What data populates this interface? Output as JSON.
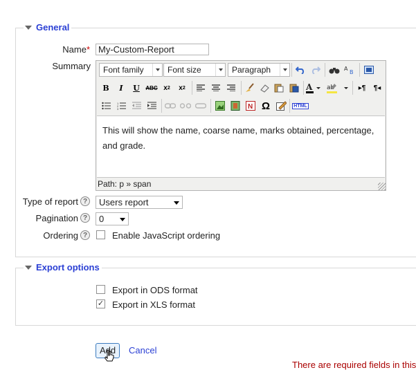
{
  "general": {
    "legend": "General",
    "name_label": "Name",
    "name_required_mark": "*",
    "name_value": "My-Custom-Report",
    "summary_label": "Summary",
    "editor": {
      "font_family": "Font family",
      "font_size": "Font size",
      "format": "Paragraph",
      "content": "This will show the name, coarse name, marks obtained, percentage, and  grade.",
      "path": "Path: p » span",
      "html_button": "HTML"
    },
    "type_label": "Type of report",
    "type_value": "Users report",
    "pagination_label": "Pagination",
    "pagination_value": "0",
    "ordering_label": "Ordering",
    "ordering_option": "Enable JavaScript ordering",
    "ordering_checked": false
  },
  "export": {
    "legend": "Export options",
    "ods_label": "Export in ODS format",
    "ods_checked": false,
    "xls_label": "Export in XLS format",
    "xls_checked": true
  },
  "actions": {
    "add_label": "Add",
    "cancel_label": "Cancel",
    "required_note": "There are required fields in this"
  },
  "colors": {
    "legend": "#2a3fd4",
    "required": "#cc0000",
    "required_note": "#aa0000"
  }
}
